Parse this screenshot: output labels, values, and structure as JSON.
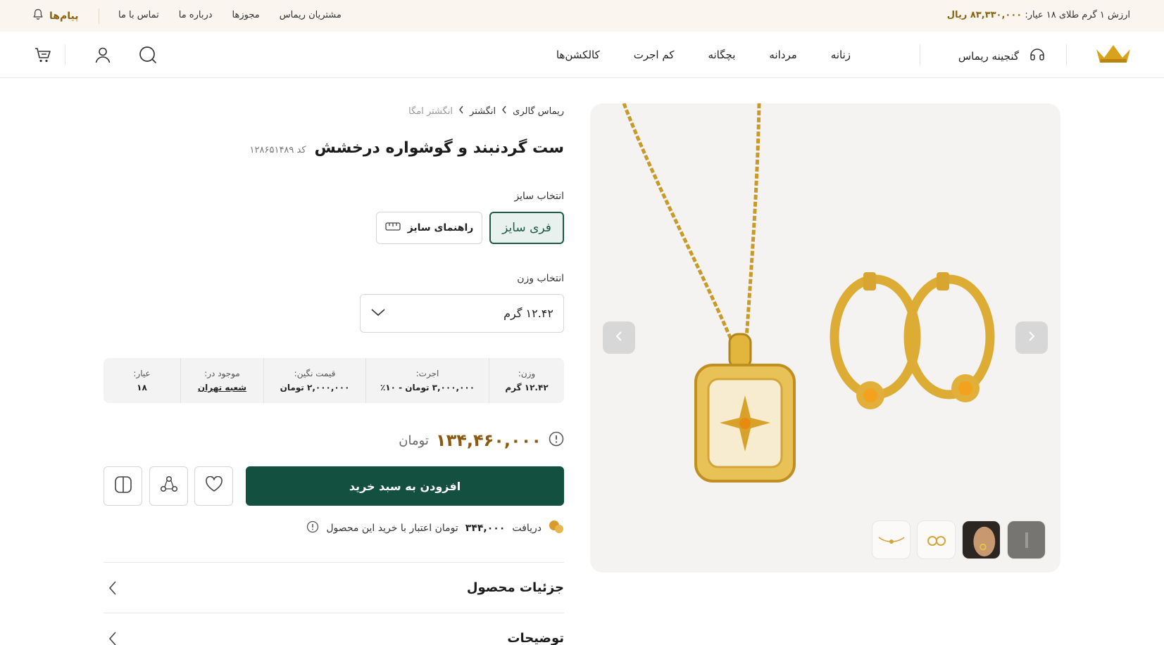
{
  "topbar": {
    "gold_price_label": "ارزش ۱ گرم طلای ۱۸ عیار:",
    "gold_price_value": "۸۳,۳۳۰,۰۰۰ ریال",
    "links": [
      "مشتریان ریماس",
      "مجوزها",
      "درباره ما",
      "تماس با ما"
    ],
    "messages_label": "پیام‌ها"
  },
  "header": {
    "treasury_label": "گنجینه ریماس",
    "nav": [
      "زنانه",
      "مردانه",
      "بچگانه",
      "کم اجرت",
      "کالکشن‌ها"
    ]
  },
  "breadcrumb": [
    "ریماس گالری",
    "انگشتر",
    "انگشتر امگا"
  ],
  "product": {
    "title": "ست گردنبند و گوشواره درخشش",
    "code_label": "کد",
    "code": "۱۲۸۶۵۱۴۸۹",
    "size_label": "انتخاب سایز",
    "size_selected": "فری سایز",
    "size_guide": "راهنمای سایز",
    "weight_label": "انتخاب وزن",
    "weight_value": "۱۲.۴۲ گرم",
    "specs": [
      {
        "key": "وزن:",
        "value": "۱۲.۴۲ گرم"
      },
      {
        "key": "اجرت:",
        "value": "۳,۰۰۰,۰۰۰ تومان - ۱۰٪"
      },
      {
        "key": "قیمت نگین:",
        "value": "۲,۰۰۰,۰۰۰ تومان"
      },
      {
        "key": "موجود در:",
        "value": "شعبه تهران"
      },
      {
        "key": "عیار:",
        "value": "۱۸"
      }
    ],
    "price": "۱۳۴,۴۶۰,۰۰۰",
    "currency": "تومان",
    "add_to_cart": "افزودن به سبد خرید",
    "credit_prefix": "دریافت",
    "credit_amount": "۳۴۴,۰۰۰",
    "credit_suffix": "تومان اعتبار با خرید این محصول"
  },
  "accordion": [
    "جزئیات محصول",
    "توضیحات"
  ],
  "colors": {
    "brand_green": "#14503f",
    "gold": "#8a5a10",
    "topbar_bg": "#faf6ef"
  }
}
